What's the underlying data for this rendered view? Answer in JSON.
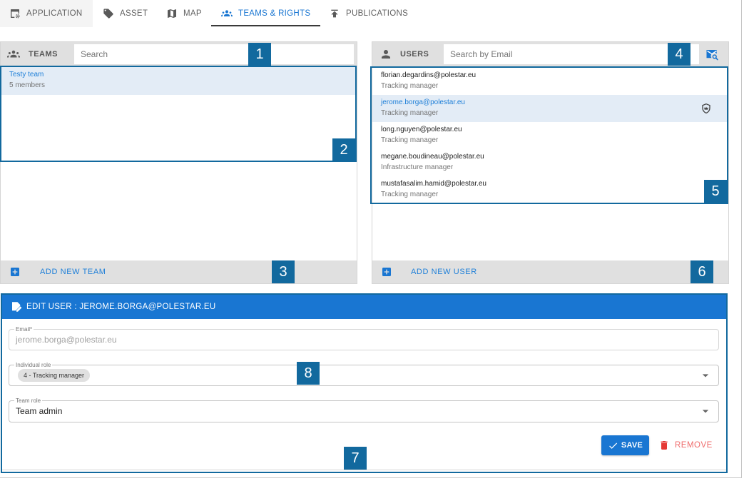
{
  "colors": {
    "accent": "#1976d2",
    "link": "#1e7fd8",
    "annotation": "#12699e",
    "selected_row": "#e3ecf6",
    "panel_header": "#e0e0e0",
    "remove": "#e53935"
  },
  "tabs": [
    {
      "label": "APPLICATION",
      "icon": "application-settings-icon",
      "active": false
    },
    {
      "label": "ASSET",
      "icon": "tag-icon",
      "active": false
    },
    {
      "label": "MAP",
      "icon": "map-icon",
      "active": false
    },
    {
      "label": "TEAMS & RIGHTS",
      "icon": "people-group-icon",
      "active": true
    },
    {
      "label": "PUBLICATIONS",
      "icon": "publish-upload-icon",
      "active": false
    }
  ],
  "teams_panel": {
    "icon": "people-group-icon",
    "title": "TEAMS",
    "search_placeholder": "Search",
    "search_value": "",
    "items": [
      {
        "name": "Testy team",
        "members": "5 members",
        "selected": true
      }
    ],
    "add_icon": "add-box-icon",
    "add_label": "ADD NEW TEAM"
  },
  "users_panel": {
    "icon": "person-icon",
    "title": "USERS",
    "search_placeholder": "Search by Email",
    "search_value": "",
    "search_mode_icon": "email-search-icon",
    "items": [
      {
        "email": "florian.degardins@polestar.eu",
        "role": "Tracking manager",
        "selected": false
      },
      {
        "email": "jerome.borga@polestar.eu",
        "role": "Tracking manager",
        "selected": true,
        "badge_icon": "team-admin-shield-icon"
      },
      {
        "email": "long.nguyen@polestar.eu",
        "role": "Tracking manager",
        "selected": false
      },
      {
        "email": "megane.boudineau@polestar.eu",
        "role": "Infrastructure manager",
        "selected": false
      },
      {
        "email": "mustafasalim.hamid@polestar.eu",
        "role": "Tracking manager",
        "selected": false
      }
    ],
    "add_icon": "add-box-icon",
    "add_label": "ADD NEW USER"
  },
  "edit_user": {
    "header_icon": "edit-document-icon",
    "title": "EDIT USER : JEROME.BORGA@POLESTAR.EU",
    "email": {
      "label": "Email*",
      "value": "jerome.borga@polestar.eu",
      "disabled": true
    },
    "individual_role": {
      "label": "Individual role",
      "selected": "4 - Tracking manager"
    },
    "team_role": {
      "label": "Team role",
      "selected": "Team admin"
    },
    "save": {
      "icon": "check-icon",
      "label": "SAVE"
    },
    "remove": {
      "icon": "trash-icon",
      "label": "REMOVE"
    }
  },
  "annotation_badges": [
    "1",
    "2",
    "3",
    "4",
    "5",
    "6",
    "7",
    "8"
  ]
}
